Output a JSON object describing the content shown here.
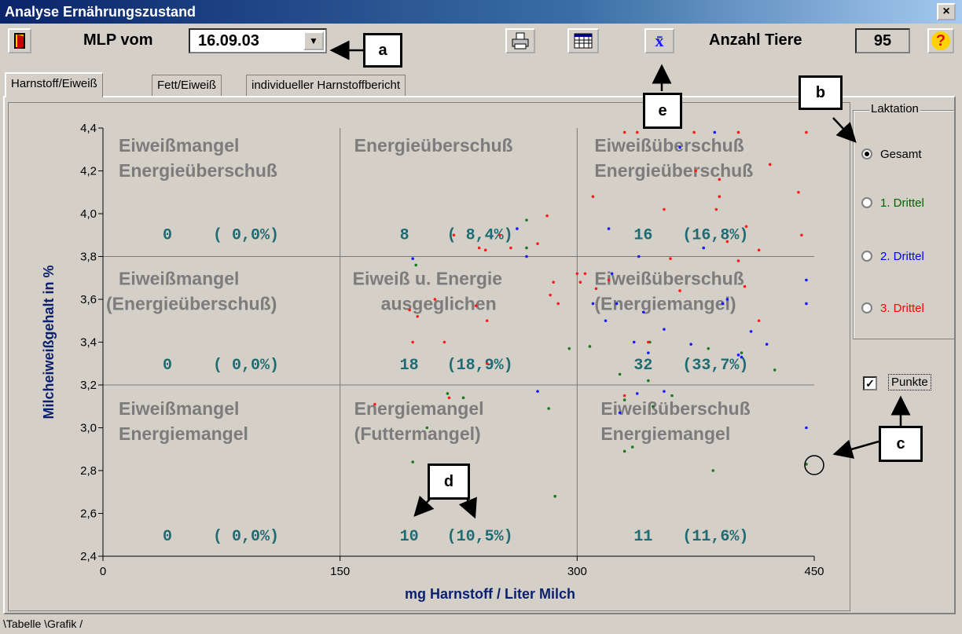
{
  "window": {
    "title": "Analyse Ernährungszustand",
    "close_label": "×"
  },
  "toolbar": {
    "mlp_label": "MLP vom",
    "date_value": "16.09.03",
    "dropdown_arrow": "▼",
    "anzahl_label": "Anzahl Tiere",
    "anzahl_value": "95",
    "help_label": "?",
    "mean_label": "x̄",
    "icons": [
      "exit-door-icon",
      "print-icon",
      "table-icon",
      "mean-icon",
      "help-icon"
    ]
  },
  "tabs": [
    {
      "label": "Harnstoff/Eiweiß",
      "active": true
    },
    {
      "label": "Fett/Eiweiß",
      "active": false
    },
    {
      "label": "individueller Harnstoffbericht",
      "active": false
    }
  ],
  "callouts": {
    "a": "a",
    "b": "b",
    "c": "c",
    "d": "d",
    "e": "e"
  },
  "lactation": {
    "legend": "Laktation",
    "options": [
      {
        "label": "Gesamt",
        "selected": true,
        "color": "#000000"
      },
      {
        "label": "1. Drittel",
        "selected": false,
        "color": "#006400"
      },
      {
        "label": "2. Drittel",
        "selected": false,
        "color": "#0000ff"
      },
      {
        "label": "3. Drittel",
        "selected": false,
        "color": "#ff0000"
      }
    ]
  },
  "points_checkbox": {
    "label": "Punkte",
    "checked": true,
    "mark": "✓"
  },
  "bottom_tabs": {
    "text": "\\Tabelle \\Grafik /"
  },
  "chart_data": {
    "type": "scatter",
    "xlabel": "mg Harnstoff / Liter Milch",
    "ylabel": "Milcheiweißgehalt in %",
    "xlim": [
      0,
      450
    ],
    "ylim": [
      2.4,
      4.4
    ],
    "x_ticks": [
      "0",
      "150",
      "300",
      "450"
    ],
    "y_ticks": [
      "2,4",
      "2,6",
      "2,8",
      "3,0",
      "3,2",
      "3,4",
      "3,6",
      "3,8",
      "4,0",
      "4,2",
      "4,4"
    ],
    "threshold_x": [
      150,
      300
    ],
    "threshold_y": [
      3.2,
      3.8
    ],
    "zones": [
      {
        "lines": [
          "Eiweißmangel",
          "Energieüberschuß"
        ],
        "count": "0",
        "pct": "( 0,0%)"
      },
      {
        "lines": [
          "Energieüberschuß"
        ],
        "count": "8",
        "pct": "( 8,4%)"
      },
      {
        "lines": [
          "Eiweißüberschuß",
          "Energieüberschuß"
        ],
        "count": "16",
        "pct": "(16,8%)"
      },
      {
        "lines": [
          "Eiweißmangel",
          "(Energieüberschuß)"
        ],
        "count": "0",
        "pct": "( 0,0%)"
      },
      {
        "lines": [
          "Eiweiß u. Energie",
          "ausgeglichen"
        ],
        "count": "18",
        "pct": "(18,9%)"
      },
      {
        "lines": [
          "Eiweißüberschuß",
          "(Energiemangel)"
        ],
        "count": "32",
        "pct": "(33,7%)"
      },
      {
        "lines": [
          "Eiweißmangel",
          "Energiemangel"
        ],
        "count": "0",
        "pct": "( 0,0%)"
      },
      {
        "lines": [
          "Energiemangel",
          "(Futtermangel)"
        ],
        "count": "10",
        "pct": "(10,5%)"
      },
      {
        "lines": [
          "Eiweißüberschuß",
          "Energiemangel"
        ],
        "count": "11",
        "pct": "(11,6%)"
      }
    ],
    "series": [
      {
        "name": "1. Drittel",
        "color": "#1a7a1a",
        "points": [
          [
            198,
            3.76
          ],
          [
            268,
            3.97
          ],
          [
            268,
            3.84
          ],
          [
            295,
            3.37
          ],
          [
            346,
            3.4
          ],
          [
            383,
            3.37
          ],
          [
            404,
            3.35
          ],
          [
            425,
            3.27
          ],
          [
            330,
            3.13
          ],
          [
            327,
            3.25
          ],
          [
            345,
            3.22
          ],
          [
            348,
            3.1
          ],
          [
            360,
            3.15
          ],
          [
            335,
            2.91
          ],
          [
            330,
            2.89
          ],
          [
            386,
            2.8
          ],
          [
            445,
            2.83
          ],
          [
            218,
            3.16
          ],
          [
            228,
            3.14
          ],
          [
            196,
            2.84
          ],
          [
            205,
            3.0
          ],
          [
            282,
            3.09
          ],
          [
            286,
            2.68
          ],
          [
            308,
            3.38
          ]
        ]
      },
      {
        "name": "2. Drittel",
        "color": "#1a1aff",
        "points": [
          [
            196,
            3.79
          ],
          [
            262,
            3.93
          ],
          [
            268,
            3.8
          ],
          [
            339,
            3.8
          ],
          [
            342,
            3.54
          ],
          [
            380,
            3.84
          ],
          [
            395,
            3.6
          ],
          [
            410,
            3.45
          ],
          [
            355,
            3.46
          ],
          [
            322,
            3.72
          ],
          [
            310,
            3.58
          ],
          [
            318,
            3.5
          ],
          [
            336,
            3.4
          ],
          [
            345,
            3.35
          ],
          [
            372,
            3.39
          ],
          [
            392,
            3.58
          ],
          [
            402,
            3.34
          ],
          [
            420,
            3.39
          ],
          [
            404,
            3.33
          ],
          [
            445,
            3.58
          ],
          [
            445,
            3.69
          ],
          [
            338,
            3.16
          ],
          [
            327,
            3.07
          ],
          [
            355,
            3.17
          ],
          [
            275,
            3.17
          ],
          [
            445,
            3.0
          ],
          [
            325,
            3.58
          ],
          [
            387,
            4.38
          ],
          [
            365,
            4.31
          ],
          [
            320,
            3.93
          ]
        ]
      },
      {
        "name": "3. Drittel",
        "color": "#ff1a1a",
        "points": [
          [
            222,
            3.9
          ],
          [
            238,
            3.84
          ],
          [
            242,
            3.83
          ],
          [
            258,
            3.84
          ],
          [
            275,
            3.86
          ],
          [
            281,
            3.99
          ],
          [
            251,
            3.9
          ],
          [
            194,
            3.55
          ],
          [
            199,
            3.52
          ],
          [
            236,
            3.57
          ],
          [
            243,
            3.5
          ],
          [
            283,
            3.62
          ],
          [
            288,
            3.58
          ],
          [
            300,
            3.72
          ],
          [
            302,
            3.68
          ],
          [
            196,
            3.4
          ],
          [
            216,
            3.4
          ],
          [
            210,
            3.6
          ],
          [
            172,
            3.11
          ],
          [
            219,
            3.14
          ],
          [
            285,
            3.68
          ],
          [
            243,
            3.3
          ],
          [
            338,
            4.38
          ],
          [
            374,
            4.38
          ],
          [
            402,
            4.38
          ],
          [
            445,
            4.38
          ],
          [
            375,
            4.2
          ],
          [
            390,
            4.16
          ],
          [
            390,
            4.08
          ],
          [
            388,
            4.02
          ],
          [
            422,
            4.23
          ],
          [
            440,
            4.1
          ],
          [
            442,
            3.9
          ],
          [
            407,
            3.94
          ],
          [
            415,
            3.83
          ],
          [
            359,
            3.79
          ],
          [
            365,
            3.64
          ],
          [
            395,
            3.87
          ],
          [
            402,
            3.78
          ],
          [
            305,
            3.72
          ],
          [
            320,
            3.69
          ],
          [
            312,
            3.65
          ],
          [
            330,
            3.15
          ],
          [
            345,
            3.4
          ],
          [
            310,
            4.08
          ],
          [
            330,
            4.38
          ],
          [
            355,
            4.02
          ],
          [
            406,
            3.66
          ],
          [
            415,
            3.5
          ]
        ]
      }
    ]
  }
}
